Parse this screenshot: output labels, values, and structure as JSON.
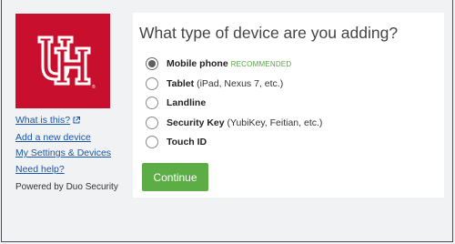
{
  "sidebar": {
    "logo_text": "UH",
    "links": [
      {
        "label": "What is this?",
        "external": true
      },
      {
        "label": "Add a new device"
      },
      {
        "label": "My Settings & Devices"
      },
      {
        "label": "Need help?"
      }
    ],
    "powered_by": "Powered by Duo Security"
  },
  "main": {
    "heading": "What type of device are you adding?",
    "options": [
      {
        "label": "Mobile phone",
        "detail": "",
        "badge": "RECOMMENDED",
        "selected": true
      },
      {
        "label": "Tablet",
        "detail": " (iPad, Nexus 7, etc.)",
        "badge": "",
        "selected": false
      },
      {
        "label": "Landline",
        "detail": "",
        "badge": "",
        "selected": false
      },
      {
        "label": "Security Key",
        "detail": " (YubiKey, Feitian, etc.)",
        "badge": "",
        "selected": false
      },
      {
        "label": "Touch ID",
        "detail": "",
        "badge": "",
        "selected": false
      }
    ],
    "continue_label": "Continue"
  },
  "colors": {
    "brand_red": "#c8102e",
    "button_green": "#5cad46",
    "badge_green": "#5aa642",
    "link_blue": "#1a56a8"
  },
  "icons": {
    "logo": "uh-interlocking-logo",
    "external_link": "external-link-icon"
  }
}
